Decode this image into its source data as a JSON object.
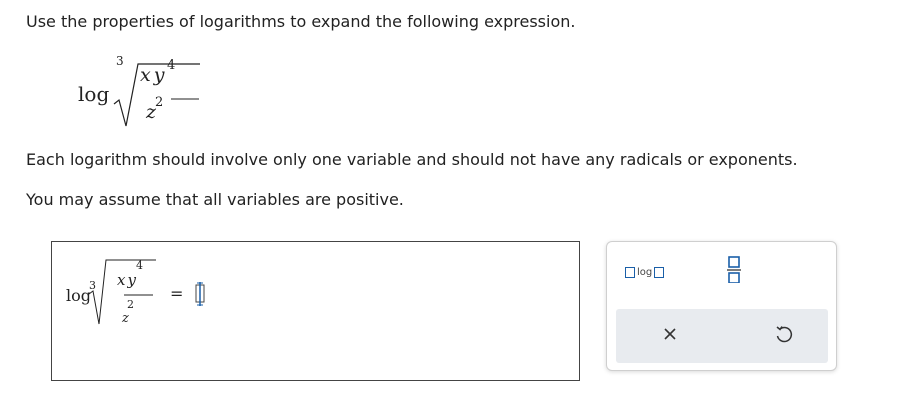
{
  "instructions": {
    "line1": "Use the properties of logarithms to expand the following expression.",
    "line2": "Each logarithm should involve only one variable and should not have any radicals or exponents.",
    "line3": "You may assume that all variables are positive."
  },
  "expression": {
    "func": "log",
    "root_index": "3",
    "numerator": "xy",
    "num_exponent": "4",
    "denominator": "z",
    "den_exponent": "2"
  },
  "answer": {
    "func": "log",
    "root_index": "3",
    "numerator": "xy",
    "num_exponent": "4",
    "denominator": "z",
    "den_exponent": "2",
    "equals": "="
  },
  "tools": {
    "log_template_label": "log",
    "clear_icon": "×",
    "undo_icon": "undo-icon"
  },
  "colors": {
    "accent": "#1a5fa8",
    "action_bar": "#e8ebef",
    "cursor_blue": "#1a5fa8"
  }
}
